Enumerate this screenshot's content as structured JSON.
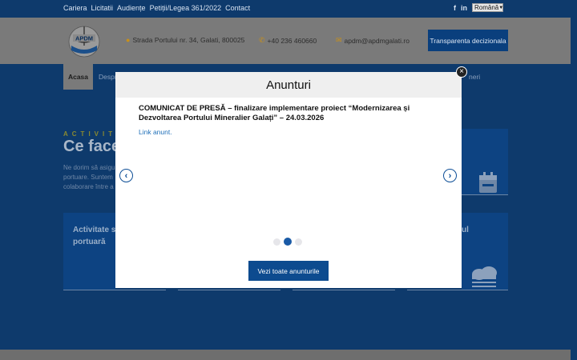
{
  "topbar": {
    "links": [
      "Cariera",
      "Licitatii",
      "Audiențe",
      "Petiții/Legea 361/2022",
      "Contact"
    ],
    "social": [
      "f",
      "in"
    ],
    "language": "Română"
  },
  "header": {
    "logo_text": "APDM",
    "address": "Strada Portului nr. 34, Galati, 800025",
    "phone": "+40 236 460660",
    "email": "apdm@apdmgalati.ro",
    "transparency_button": "Transparenta decizionala"
  },
  "nav": {
    "active": "Acasa",
    "partial_left": "Despr",
    "partial_right": "neri"
  },
  "background": {
    "section_kicker": "ACTIVIT",
    "section_title": "Ce face",
    "section_text": [
      "Ne dorim să asigu",
      "portuare. Suntem",
      "colaborare între a"
    ],
    "card_title_left": [
      "Activitate sp",
      "portuară"
    ],
    "card_title_right": "ul"
  },
  "modal": {
    "title": "Anunturi",
    "close_label": "×",
    "announcement_title": "COMUNICAT DE PRESĂ – finalizare implementare proiect “Modernizarea și Dezvoltarea Portului Mineralier Galați” – 24.03.2026",
    "announcement_link": "Link anunt.",
    "prev_label": "‹",
    "next_label": "›",
    "slides_total": 3,
    "slide_active": 2,
    "all_button": "Vezi toate anunturile"
  },
  "colors": {
    "brand_dark": "#0e3a6c",
    "button_blue": "#0d4b8f",
    "link_blue": "#1f6fb8"
  }
}
